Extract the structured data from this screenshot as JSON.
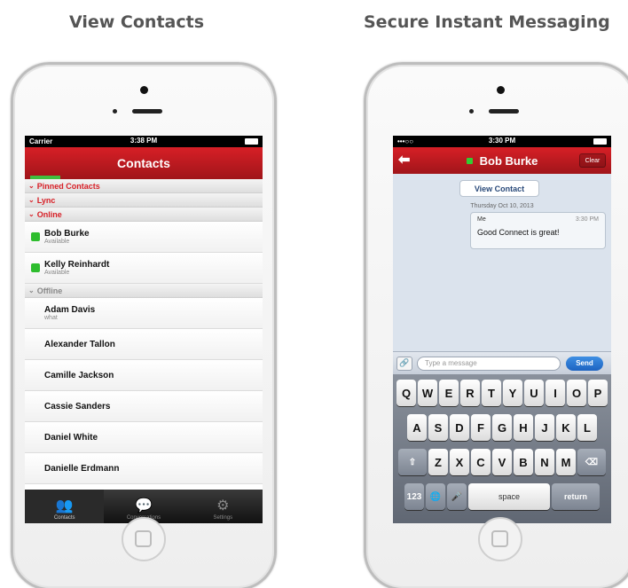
{
  "captions": {
    "left": "View Contacts",
    "right": "Secure Instant Messaging"
  },
  "left_screen": {
    "status": {
      "carrier": "Carrier",
      "time": "3:38 PM"
    },
    "title": "Contacts",
    "groups": {
      "pinned": "Pinned Contacts",
      "lync": "Lync",
      "online": "Online",
      "offline": "Offline"
    },
    "online_contacts": [
      {
        "name": "Bob Burke",
        "status": "Available"
      },
      {
        "name": "Kelly Reinhardt",
        "status": "Available"
      }
    ],
    "offline_contacts": [
      {
        "name": "Adam Davis",
        "status": "what"
      },
      {
        "name": "Alexander Tallon",
        "status": ""
      },
      {
        "name": "Camille Jackson",
        "status": ""
      },
      {
        "name": "Cassie Sanders",
        "status": ""
      },
      {
        "name": "Daniel White",
        "status": ""
      },
      {
        "name": "Danielle Erdmann",
        "status": ""
      }
    ],
    "tabs": [
      {
        "label": "Contacts",
        "icon": "contacts-icon"
      },
      {
        "label": "Conversations",
        "icon": "conversations-icon"
      },
      {
        "label": "Settings",
        "icon": "settings-icon"
      }
    ]
  },
  "right_screen": {
    "status": {
      "time": "3:30 PM"
    },
    "title": "Bob Burke",
    "clear_label": "Clear",
    "view_contact_label": "View Contact",
    "date": "Thursday Oct 10, 2013",
    "message": {
      "sender": "Me",
      "time": "3:30 PM",
      "text": "Good Connect is great!"
    },
    "input_placeholder": "Type a message",
    "send_label": "Send",
    "keyboard": {
      "row1": [
        "Q",
        "W",
        "E",
        "R",
        "T",
        "Y",
        "U",
        "I",
        "O",
        "P"
      ],
      "row2": [
        "A",
        "S",
        "D",
        "F",
        "G",
        "H",
        "J",
        "K",
        "L"
      ],
      "row3": [
        "Z",
        "X",
        "C",
        "V",
        "B",
        "N",
        "M"
      ],
      "numbers": "123",
      "space": "space",
      "return": "return"
    }
  },
  "colors": {
    "accent": "#d71f26",
    "presence": "#2ebd2e",
    "send": "#1d63c1"
  }
}
